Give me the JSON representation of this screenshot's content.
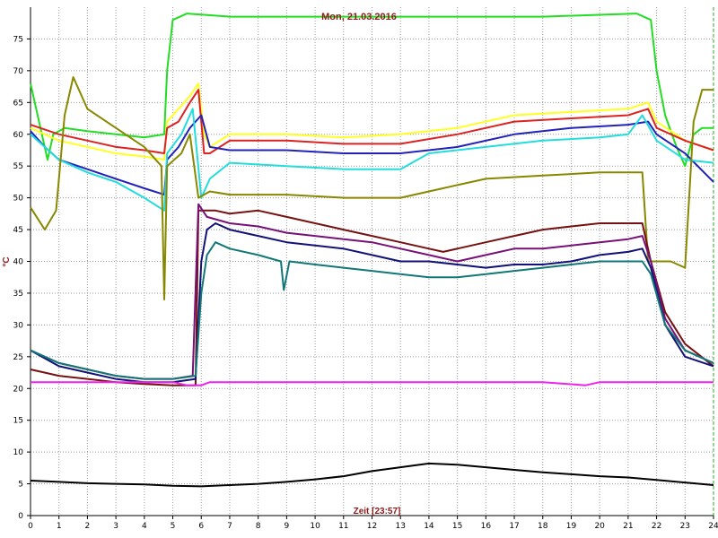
{
  "chart_data": {
    "type": "line",
    "title": "Mon, 21.03.2016",
    "xlabel": "Zeit [23:57]",
    "ylabel": "°C",
    "xlim": [
      0,
      24
    ],
    "ylim": [
      0,
      80
    ],
    "x_ticks": [
      "0",
      "1",
      "2",
      "3",
      "4",
      "5",
      "6",
      "7",
      "8",
      "9",
      "10",
      "11",
      "12",
      "13",
      "14",
      "15",
      "16",
      "17",
      "18",
      "19",
      "20",
      "21",
      "22",
      "23",
      "24"
    ],
    "y_ticks": [
      "0",
      "5",
      "10",
      "15",
      "20",
      "25",
      "30",
      "35",
      "40",
      "45",
      "50",
      "55",
      "60",
      "65",
      "70",
      "75"
    ],
    "grid": true,
    "series": [
      {
        "color": "#22dd22",
        "points": [
          [
            0,
            68
          ],
          [
            0.3,
            62
          ],
          [
            0.6,
            56
          ],
          [
            0.8,
            60
          ],
          [
            1.2,
            61
          ],
          [
            2,
            60.5
          ],
          [
            3,
            60
          ],
          [
            4,
            59.5
          ],
          [
            4.7,
            60
          ],
          [
            4.8,
            70
          ],
          [
            5,
            78
          ],
          [
            5.5,
            79
          ],
          [
            7,
            78.5
          ],
          [
            10,
            78.5
          ],
          [
            14,
            78.5
          ],
          [
            18,
            78.5
          ],
          [
            21.3,
            79
          ],
          [
            21.8,
            78
          ],
          [
            22,
            70
          ],
          [
            22.3,
            63
          ],
          [
            22.7,
            58
          ],
          [
            23,
            55
          ],
          [
            23.3,
            60
          ],
          [
            23.6,
            61
          ],
          [
            24,
            61
          ]
        ]
      },
      {
        "color": "#ffff22",
        "points": [
          [
            0,
            61
          ],
          [
            1,
            59
          ],
          [
            2,
            58
          ],
          [
            3,
            57
          ],
          [
            4,
            56.5
          ],
          [
            4.7,
            56
          ],
          [
            4.8,
            62
          ],
          [
            5.2,
            64
          ],
          [
            5.6,
            66
          ],
          [
            5.9,
            68
          ],
          [
            6.1,
            60
          ],
          [
            6.3,
            58
          ],
          [
            7,
            60
          ],
          [
            9,
            60
          ],
          [
            11,
            59.5
          ],
          [
            13,
            60
          ],
          [
            15,
            61
          ],
          [
            17,
            63
          ],
          [
            19,
            63.5
          ],
          [
            21,
            64
          ],
          [
            21.7,
            65
          ],
          [
            22,
            62
          ],
          [
            23,
            59
          ],
          [
            24,
            57.5
          ]
        ]
      },
      {
        "color": "#dd2222",
        "points": [
          [
            0,
            61.5
          ],
          [
            1,
            60
          ],
          [
            2,
            59
          ],
          [
            3,
            58
          ],
          [
            4,
            57.5
          ],
          [
            4.7,
            57
          ],
          [
            4.8,
            61
          ],
          [
            5.2,
            62
          ],
          [
            5.6,
            65
          ],
          [
            5.9,
            67
          ],
          [
            6.1,
            57
          ],
          [
            6.3,
            57
          ],
          [
            7,
            59
          ],
          [
            9,
            59
          ],
          [
            11,
            58.5
          ],
          [
            13,
            58.5
          ],
          [
            15,
            60
          ],
          [
            17,
            62
          ],
          [
            19,
            62.5
          ],
          [
            21,
            63
          ],
          [
            21.7,
            64
          ],
          [
            22,
            61
          ],
          [
            23,
            59
          ],
          [
            24,
            57.5
          ]
        ]
      },
      {
        "color": "#2222bb",
        "points": [
          [
            0,
            60.5
          ],
          [
            0.5,
            58
          ],
          [
            1,
            56
          ],
          [
            2,
            54.5
          ],
          [
            3,
            53
          ],
          [
            4,
            51.5
          ],
          [
            4.7,
            50.5
          ],
          [
            4.8,
            56
          ],
          [
            5.2,
            58
          ],
          [
            5.6,
            61
          ],
          [
            6,
            63
          ],
          [
            6.3,
            58
          ],
          [
            7,
            57.5
          ],
          [
            9,
            57.5
          ],
          [
            11,
            57
          ],
          [
            13,
            57
          ],
          [
            15,
            58
          ],
          [
            17,
            60
          ],
          [
            19,
            61
          ],
          [
            21,
            61.5
          ],
          [
            21.7,
            62
          ],
          [
            22,
            60
          ],
          [
            23,
            57
          ],
          [
            24,
            52.5
          ]
        ]
      },
      {
        "color": "#22dddd",
        "points": [
          [
            0,
            60
          ],
          [
            1,
            56
          ],
          [
            2,
            54
          ],
          [
            3,
            52.5
          ],
          [
            4,
            50
          ],
          [
            4.7,
            48
          ],
          [
            4.8,
            57
          ],
          [
            5.3,
            60
          ],
          [
            5.7,
            64
          ],
          [
            6,
            50
          ],
          [
            6.3,
            53
          ],
          [
            7,
            55.5
          ],
          [
            9,
            55
          ],
          [
            11,
            54.5
          ],
          [
            13,
            54.5
          ],
          [
            14,
            57
          ],
          [
            16,
            58
          ],
          [
            18,
            59
          ],
          [
            20,
            59.5
          ],
          [
            21,
            60
          ],
          [
            21.5,
            63
          ],
          [
            22,
            59
          ],
          [
            23,
            56
          ],
          [
            24,
            55.5
          ]
        ]
      },
      {
        "color": "#888800",
        "points": [
          [
            0,
            48.5
          ],
          [
            0.5,
            45
          ],
          [
            0.9,
            48
          ],
          [
            1.2,
            63
          ],
          [
            1.5,
            69
          ],
          [
            2,
            64
          ],
          [
            3,
            61
          ],
          [
            4,
            58
          ],
          [
            4.6,
            55
          ],
          [
            4.7,
            34
          ],
          [
            4.8,
            55
          ],
          [
            5.3,
            57
          ],
          [
            5.6,
            60
          ],
          [
            5.9,
            50
          ],
          [
            6.3,
            51
          ],
          [
            7,
            50.5
          ],
          [
            9,
            50.5
          ],
          [
            11,
            50
          ],
          [
            13,
            50
          ],
          [
            14,
            51
          ],
          [
            15,
            52
          ],
          [
            16,
            53
          ],
          [
            18,
            53.5
          ],
          [
            20,
            54
          ],
          [
            21.5,
            54
          ],
          [
            21.7,
            40
          ],
          [
            22.5,
            40
          ],
          [
            23,
            39
          ],
          [
            23.3,
            62
          ],
          [
            23.6,
            67
          ],
          [
            24,
            67
          ]
        ]
      },
      {
        "color": "#771111",
        "points": [
          [
            0,
            23
          ],
          [
            1,
            22
          ],
          [
            2,
            21.5
          ],
          [
            3,
            21
          ],
          [
            4,
            20.7
          ],
          [
            5,
            20.5
          ],
          [
            5.8,
            20.5
          ],
          [
            5.9,
            48
          ],
          [
            6.5,
            48
          ],
          [
            7,
            47.5
          ],
          [
            8,
            48
          ],
          [
            9,
            47
          ],
          [
            10,
            46
          ],
          [
            11,
            45
          ],
          [
            12,
            44
          ],
          [
            13,
            43
          ],
          [
            14,
            42
          ],
          [
            14.5,
            41.5
          ],
          [
            15,
            42
          ],
          [
            16,
            43
          ],
          [
            17,
            44
          ],
          [
            18,
            45
          ],
          [
            19,
            45.5
          ],
          [
            20,
            46
          ],
          [
            21,
            46
          ],
          [
            21.5,
            46
          ],
          [
            21.8,
            40
          ],
          [
            22.3,
            32
          ],
          [
            23,
            27
          ],
          [
            24,
            23.5
          ]
        ]
      },
      {
        "color": "#771177",
        "points": [
          [
            0,
            26
          ],
          [
            1,
            24
          ],
          [
            2,
            23
          ],
          [
            3,
            22
          ],
          [
            4,
            21.5
          ],
          [
            5,
            21.5
          ],
          [
            5.7,
            22
          ],
          [
            5.9,
            49
          ],
          [
            6.2,
            47
          ],
          [
            7,
            46
          ],
          [
            8,
            45.5
          ],
          [
            9,
            44.5
          ],
          [
            10,
            44
          ],
          [
            11,
            43.5
          ],
          [
            12,
            43
          ],
          [
            13,
            42
          ],
          [
            14,
            41
          ],
          [
            15,
            40
          ],
          [
            16,
            41
          ],
          [
            17,
            42
          ],
          [
            18,
            42
          ],
          [
            19,
            42.5
          ],
          [
            20,
            43
          ],
          [
            21,
            43.5
          ],
          [
            21.5,
            44
          ],
          [
            21.8,
            40
          ],
          [
            22.3,
            31
          ],
          [
            23,
            26
          ],
          [
            24,
            24
          ]
        ]
      },
      {
        "color": "#111177",
        "points": [
          [
            0,
            26
          ],
          [
            1,
            23.5
          ],
          [
            2,
            22.5
          ],
          [
            3,
            21.5
          ],
          [
            4,
            21
          ],
          [
            5,
            21
          ],
          [
            5.8,
            21.5
          ],
          [
            6,
            40
          ],
          [
            6.2,
            45
          ],
          [
            6.5,
            46
          ],
          [
            7,
            45
          ],
          [
            8,
            44
          ],
          [
            9,
            43
          ],
          [
            10,
            42.5
          ],
          [
            11,
            42
          ],
          [
            12,
            41
          ],
          [
            13,
            40
          ],
          [
            14,
            40
          ],
          [
            15,
            39.5
          ],
          [
            16,
            39
          ],
          [
            17,
            39.5
          ],
          [
            18,
            39.5
          ],
          [
            19,
            40
          ],
          [
            20,
            41
          ],
          [
            21,
            41.5
          ],
          [
            21.5,
            42
          ],
          [
            21.8,
            39
          ],
          [
            22.3,
            30
          ],
          [
            23,
            25
          ],
          [
            24,
            23.5
          ]
        ]
      },
      {
        "color": "#117777",
        "points": [
          [
            0,
            26
          ],
          [
            1,
            24
          ],
          [
            2,
            23
          ],
          [
            3,
            22
          ],
          [
            4,
            21.5
          ],
          [
            5,
            21.5
          ],
          [
            5.8,
            22
          ],
          [
            6,
            35
          ],
          [
            6.2,
            41
          ],
          [
            6.5,
            43
          ],
          [
            7,
            42
          ],
          [
            8,
            41
          ],
          [
            8.8,
            40
          ],
          [
            8.9,
            35.5
          ],
          [
            9.1,
            40
          ],
          [
            10,
            39.5
          ],
          [
            11,
            39
          ],
          [
            12,
            38.5
          ],
          [
            13,
            38
          ],
          [
            14,
            37.5
          ],
          [
            15,
            37.5
          ],
          [
            16,
            38
          ],
          [
            17,
            38.5
          ],
          [
            18,
            39
          ],
          [
            19,
            39.5
          ],
          [
            20,
            40
          ],
          [
            21,
            40
          ],
          [
            21.5,
            40
          ],
          [
            21.8,
            38
          ],
          [
            22.3,
            30
          ],
          [
            23,
            26
          ],
          [
            24,
            24
          ]
        ]
      },
      {
        "color": "#ee22ee",
        "points": [
          [
            0,
            21
          ],
          [
            1,
            21
          ],
          [
            2,
            21
          ],
          [
            3,
            21
          ],
          [
            4,
            21
          ],
          [
            5,
            21
          ],
          [
            5.5,
            20.5
          ],
          [
            6,
            20.5
          ],
          [
            6.3,
            21
          ],
          [
            8,
            21
          ],
          [
            10,
            21
          ],
          [
            12,
            21
          ],
          [
            14,
            21
          ],
          [
            16,
            21
          ],
          [
            18,
            21
          ],
          [
            19.5,
            20.5
          ],
          [
            20,
            21
          ],
          [
            21,
            21
          ],
          [
            22,
            21
          ],
          [
            24,
            21
          ]
        ]
      },
      {
        "color": "#000000",
        "points": [
          [
            0,
            5.5
          ],
          [
            1,
            5.3
          ],
          [
            2,
            5.1
          ],
          [
            3,
            5
          ],
          [
            4,
            4.9
          ],
          [
            5,
            4.7
          ],
          [
            6,
            4.6
          ],
          [
            7,
            4.8
          ],
          [
            8,
            5
          ],
          [
            9,
            5.3
          ],
          [
            10,
            5.7
          ],
          [
            11,
            6.2
          ],
          [
            12,
            7
          ],
          [
            13,
            7.6
          ],
          [
            14,
            8.2
          ],
          [
            15,
            8
          ],
          [
            16,
            7.6
          ],
          [
            17,
            7.2
          ],
          [
            18,
            6.8
          ],
          [
            19,
            6.5
          ],
          [
            20,
            6.2
          ],
          [
            21,
            6
          ],
          [
            22,
            5.6
          ],
          [
            23,
            5.2
          ],
          [
            24,
            4.8
          ]
        ]
      }
    ]
  }
}
